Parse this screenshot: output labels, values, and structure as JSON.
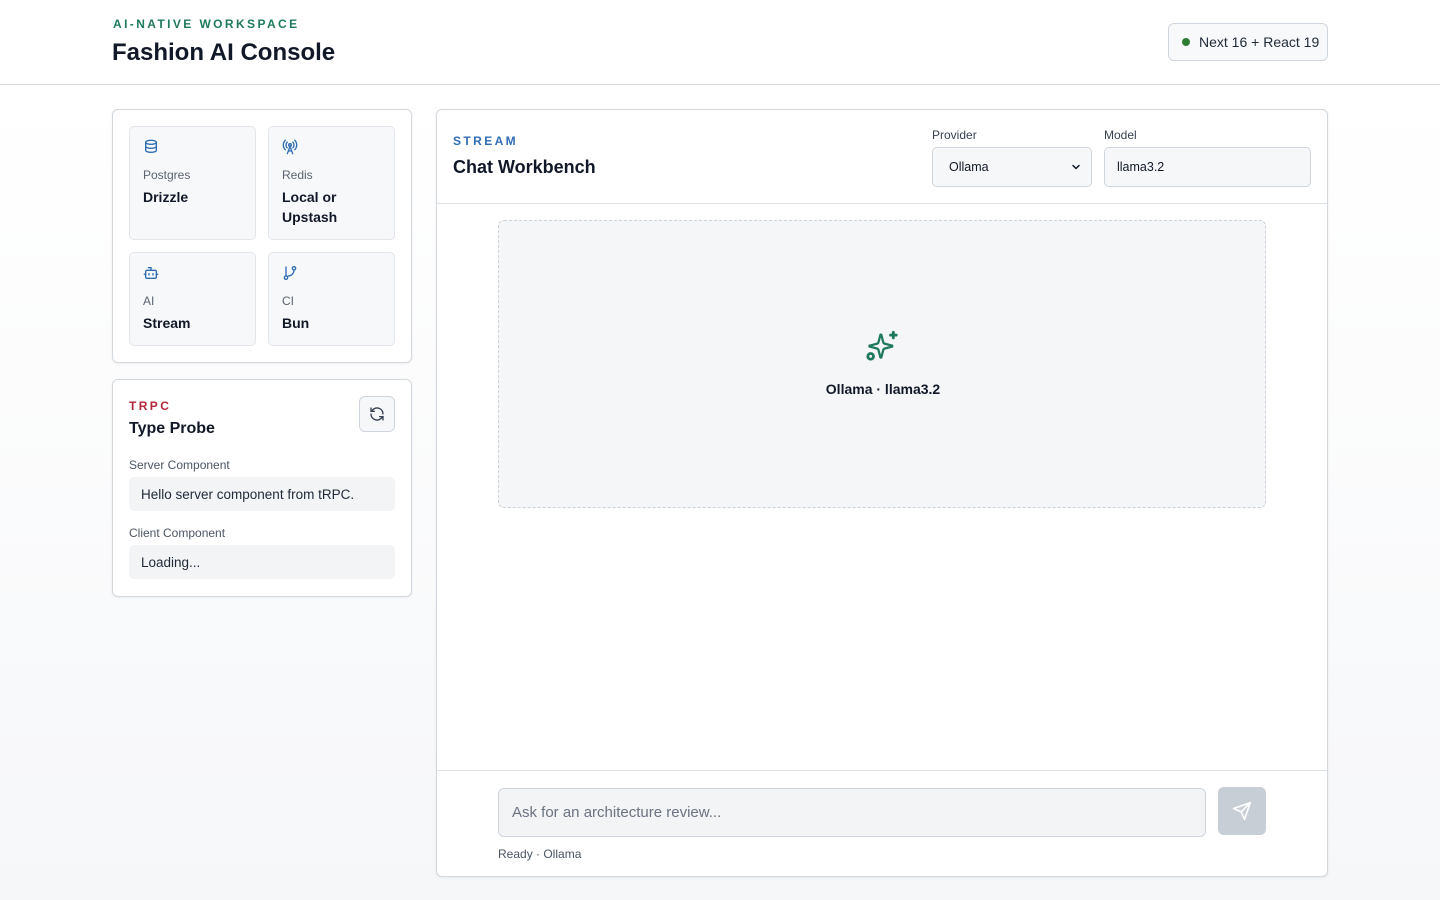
{
  "header": {
    "eyebrow": "AI-NATIVE WORKSPACE",
    "title": "Fashion AI Console",
    "version_badge": "Next 16 + React 19",
    "status_color": "#2f7d32"
  },
  "stack": {
    "tiles": [
      {
        "icon": "database-icon",
        "label": "Postgres",
        "value": "Drizzle"
      },
      {
        "icon": "radio-tower-icon",
        "label": "Redis",
        "value": "Local or Upstash"
      },
      {
        "icon": "bot-icon",
        "label": "AI",
        "value": "Stream"
      },
      {
        "icon": "git-branch-icon",
        "label": "CI",
        "value": "Bun"
      }
    ]
  },
  "probe": {
    "eyebrow": "TRPC",
    "title": "Type Probe",
    "server_label": "Server Component",
    "server_value": "Hello server component from tRPC.",
    "client_label": "Client Component",
    "client_value": "Loading..."
  },
  "chat": {
    "eyebrow": "STREAM",
    "title": "Chat Workbench",
    "provider_label": "Provider",
    "provider_value": "Ollama",
    "model_label": "Model",
    "model_value": "llama3.2",
    "empty_caption": "Ollama · llama3.2",
    "prompt_placeholder": "Ask for an architecture review...",
    "status": "Ready · Ollama"
  },
  "colors": {
    "accent_green": "#1f7a5c",
    "accent_red": "#b3263a",
    "accent_blue": "#2f6db5"
  }
}
